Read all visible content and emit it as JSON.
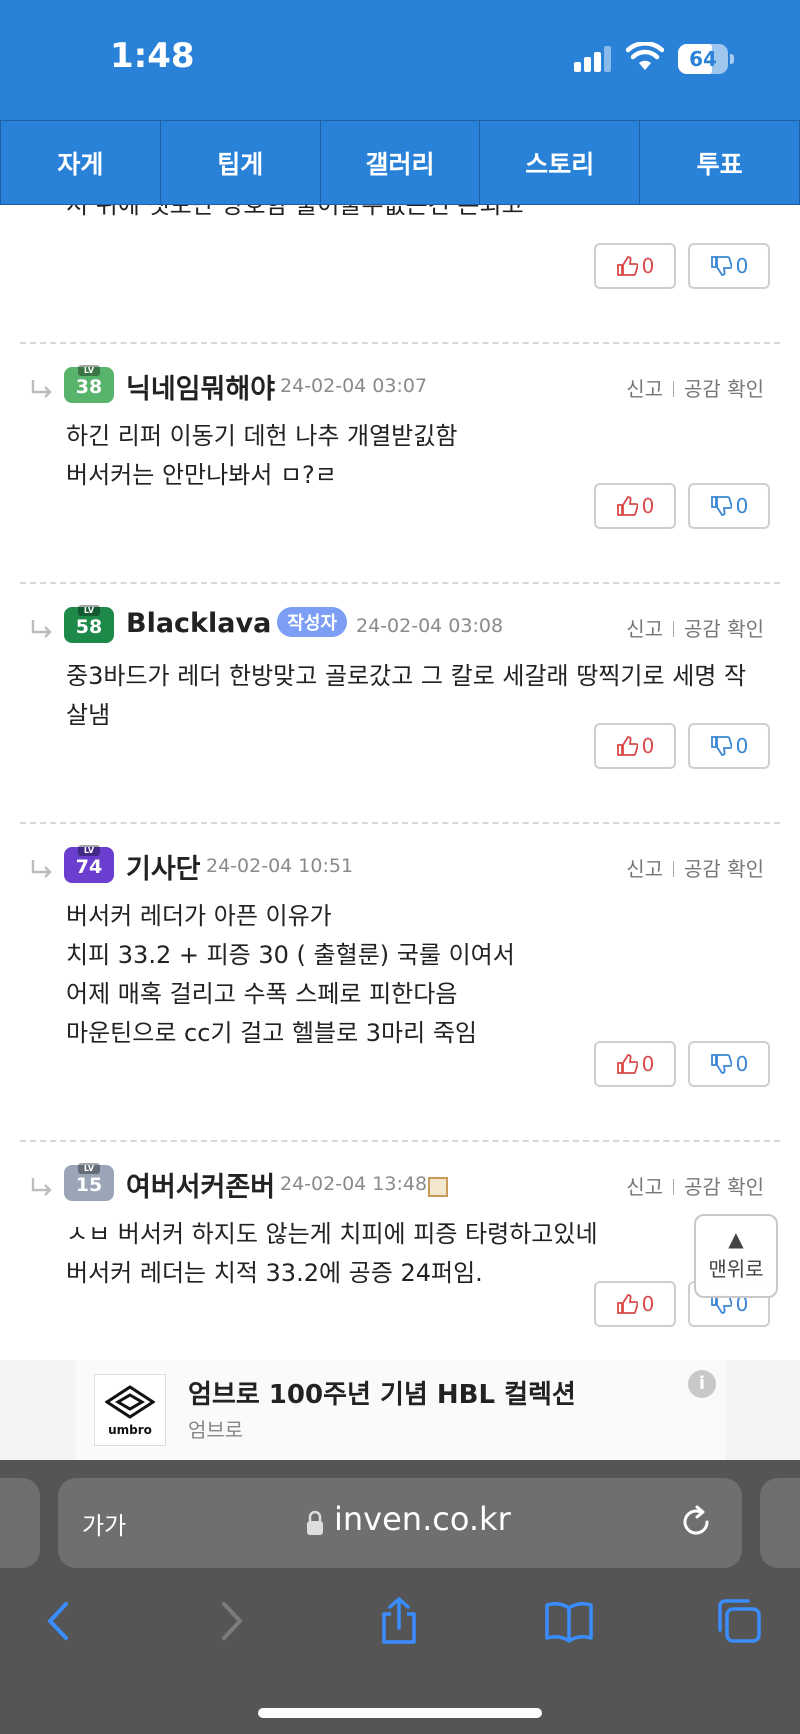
{
  "status": {
    "time": "1:48",
    "battery": "64"
  },
  "tabs": [
    "자게",
    "팁게",
    "갤러리",
    "스토리",
    "투표"
  ],
  "partial_text": "서 위에 셋보단 양호함 풀어줄수없는건 돈되고",
  "first_votes": {
    "up": "0",
    "down": "0"
  },
  "comments": [
    {
      "level": "38",
      "level_color": "#58b46a",
      "nick": "닉네임뭐해야",
      "author_badge": "",
      "date": "24-02-04 03:07",
      "lines": [
        "하긴 리퍼 이동기 데헌 나추 개열받긼함",
        "버서커는 안만나봐서 ㅁ?ㄹ"
      ],
      "up": "0",
      "down": "0"
    },
    {
      "level": "58",
      "level_color": "#1e8a4a",
      "nick": "Blacklava",
      "author_badge": "작성자",
      "date": "24-02-04 03:08",
      "lines": [
        "중3바드가 레더 한방맞고 골로갔고 그 칼로 세갈래 땅찍기로 세명 작",
        "살냄"
      ],
      "up": "0",
      "down": "0"
    },
    {
      "level": "74",
      "level_color": "#6a3fcf",
      "nick": "기사단",
      "author_badge": "",
      "date": "24-02-04 10:51",
      "lines": [
        "버서커 레더가 아픈 이유가",
        "치피 33.2 + 피증 30 ( 출혈룬) 국룰 이여서",
        "어제 매혹 걸리고 수폭 스페로 피한다음",
        "마운틴으로 cc기 걸고 헬블로 3마리 죽임"
      ],
      "up": "0",
      "down": "0"
    },
    {
      "level": "15",
      "level_color": "#9aa6b8",
      "nick": "여버서커존버",
      "author_badge": "",
      "date": "24-02-04 13:48",
      "lines": [
        "ㅅㅂ 버서커 하지도 않는게 치피에 피증 타령하고있네",
        "버서커 레더는 치적 33.2에 공증 24퍼임."
      ],
      "up": "0",
      "down": "0"
    }
  ],
  "actions": {
    "report": "신고",
    "likes": "공감 확인"
  },
  "top_button": {
    "arrow": "▲",
    "label": "맨위로"
  },
  "ad": {
    "title": "엄브로 100주년 기념 HBL 컬렉션",
    "subtitle": "엄브로",
    "brand": "umbro",
    "info": "i"
  },
  "browser": {
    "aa": "가가",
    "url": "inven.co.kr"
  }
}
